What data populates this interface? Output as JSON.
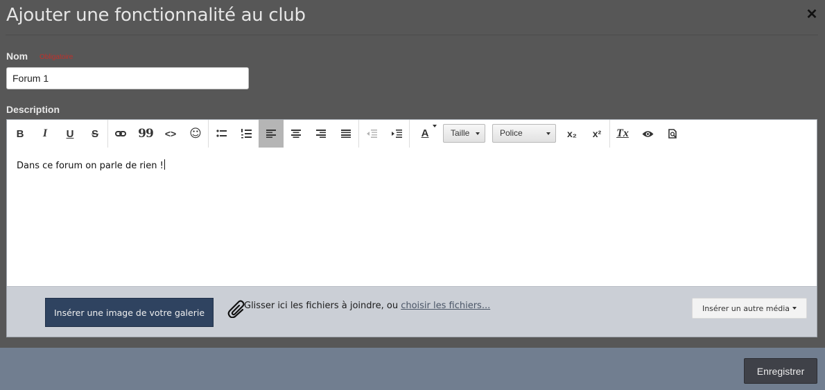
{
  "modal": {
    "title": "Ajouter une fonctionnalité au club",
    "close_glyph": "✕"
  },
  "form": {
    "name_label": "Nom",
    "required_text": "Obligatoire",
    "name_value": "Forum 1",
    "description_label": "Description"
  },
  "toolbar": {
    "bold_glyph": "B",
    "italic_glyph": "I",
    "underline_glyph": "U",
    "strike_glyph": "S",
    "quote_glyph": "99",
    "code_glyph": "<>",
    "smiley_glyph": "☺",
    "font_color_glyph": "A",
    "size_select": "Taille",
    "font_select": "Police",
    "subscript_glyph": "x₂",
    "superscript_glyph": "x²",
    "clear_format_glyph": "Tx",
    "active_align": "align-left",
    "icons": [
      "bold-icon",
      "italic-icon",
      "underline-icon",
      "strikethrough-icon",
      "link-icon",
      "quote-icon",
      "code-icon",
      "emoji-icon",
      "bulleted-list-icon",
      "numbered-list-icon",
      "align-left-icon",
      "align-center-icon",
      "align-right-icon",
      "justify-icon",
      "outdent-icon",
      "indent-icon",
      "font-color-icon",
      "subscript-icon",
      "superscript-icon",
      "remove-format-icon",
      "preview-icon",
      "document-preview-icon"
    ]
  },
  "editor": {
    "content": "Dans ce forum on parle de rien !"
  },
  "attachments": {
    "gallery_button": "Insérer une image de votre galerie",
    "drop_text": "Glisser ici les fichiers à joindre, ou ",
    "choose_link": "choisir les fichiers...",
    "media_button": "Insérer un autre média"
  },
  "footer": {
    "save_button": "Enregistrer"
  },
  "colors": {
    "overlay": "#575757",
    "footer": "#717e90",
    "gallery_button": "#2f4360",
    "save_button": "#3f4148",
    "attach_bar": "#cbcfd6",
    "required": "#c0302b"
  }
}
